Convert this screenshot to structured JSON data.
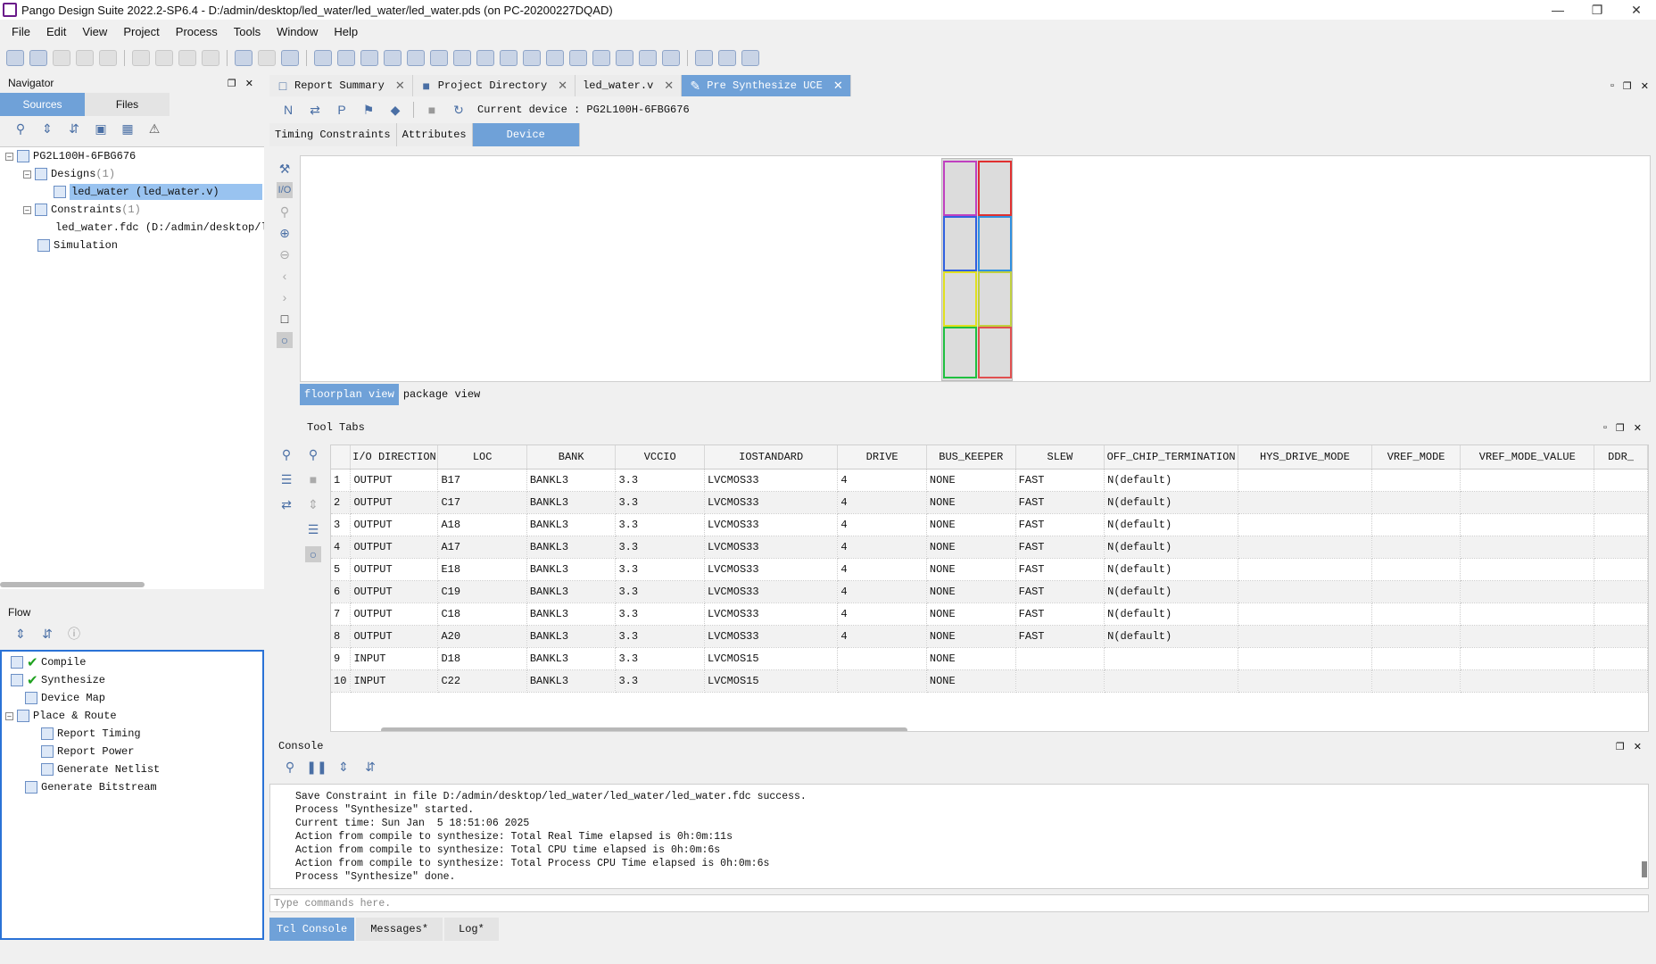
{
  "window": {
    "title": "Pango Design Suite 2022.2-SP6.4 - D:/admin/desktop/led_water/led_water/led_water.pds (on PC-20200227DQAD)"
  },
  "menu": [
    "File",
    "Edit",
    "View",
    "Project",
    "Process",
    "Tools",
    "Window",
    "Help"
  ],
  "navigator": {
    "title": "Navigator",
    "tabs": {
      "sources": "Sources",
      "files": "Files"
    },
    "tree": {
      "device": "PG2L100H-6FBG676",
      "designs": "Designs",
      "designs_count": "(1)",
      "design_item": "led_water (led_water.v)",
      "constraints": "Constraints",
      "constraints_count": "(1)",
      "constraint_item": "led_water.fdc (D:/admin/desktop/l",
      "simulation": "Simulation"
    }
  },
  "flow": {
    "title": "Flow",
    "items": {
      "compile": "Compile",
      "synthesize": "Synthesize",
      "device_map": "Device Map",
      "place_route": "Place & Route",
      "report_timing": "Report Timing",
      "report_power": "Report Power",
      "generate_netlist": "Generate Netlist",
      "generate_bitstream": "Generate Bitstream"
    }
  },
  "editor": {
    "tabs": {
      "report_summary": "Report Summary",
      "project_directory": "Project Directory",
      "led_water_v": "led_water.v",
      "pre_synth_uce": "Pre Synthesize UCE"
    },
    "current_device": "Current device : PG2L100H-6FBG676",
    "subtabs": {
      "timing": "Timing Constraints",
      "attributes": "Attributes",
      "device": "Device"
    },
    "views": {
      "floorplan": "floorplan view",
      "package": "package view"
    }
  },
  "tool_tabs": {
    "title": "Tool Tabs",
    "columns": [
      "",
      "I/O DIRECTION",
      "LOC",
      "BANK",
      "VCCIO",
      "IOSTANDARD",
      "DRIVE",
      "BUS_KEEPER",
      "SLEW",
      "OFF_CHIP_TERMINATION",
      "HYS_DRIVE_MODE",
      "VREF_MODE",
      "VREF_MODE_VALUE",
      "DDR_"
    ],
    "rows": [
      [
        "1",
        "OUTPUT",
        "B17",
        "BANKL3",
        "3.3",
        "LVCMOS33",
        "4",
        "NONE",
        "FAST",
        "N(default)",
        "",
        "",
        "",
        ""
      ],
      [
        "2",
        "OUTPUT",
        "C17",
        "BANKL3",
        "3.3",
        "LVCMOS33",
        "4",
        "NONE",
        "FAST",
        "N(default)",
        "",
        "",
        "",
        ""
      ],
      [
        "3",
        "OUTPUT",
        "A18",
        "BANKL3",
        "3.3",
        "LVCMOS33",
        "4",
        "NONE",
        "FAST",
        "N(default)",
        "",
        "",
        "",
        ""
      ],
      [
        "4",
        "OUTPUT",
        "A17",
        "BANKL3",
        "3.3",
        "LVCMOS33",
        "4",
        "NONE",
        "FAST",
        "N(default)",
        "",
        "",
        "",
        ""
      ],
      [
        "5",
        "OUTPUT",
        "E18",
        "BANKL3",
        "3.3",
        "LVCMOS33",
        "4",
        "NONE",
        "FAST",
        "N(default)",
        "",
        "",
        "",
        ""
      ],
      [
        "6",
        "OUTPUT",
        "C19",
        "BANKL3",
        "3.3",
        "LVCMOS33",
        "4",
        "NONE",
        "FAST",
        "N(default)",
        "",
        "",
        "",
        ""
      ],
      [
        "7",
        "OUTPUT",
        "C18",
        "BANKL3",
        "3.3",
        "LVCMOS33",
        "4",
        "NONE",
        "FAST",
        "N(default)",
        "",
        "",
        "",
        ""
      ],
      [
        "8",
        "OUTPUT",
        "A20",
        "BANKL3",
        "3.3",
        "LVCMOS33",
        "4",
        "NONE",
        "FAST",
        "N(default)",
        "",
        "",
        "",
        ""
      ],
      [
        "9",
        "INPUT",
        "D18",
        "BANKL3",
        "3.3",
        "LVCMOS15",
        "",
        "NONE",
        "",
        "",
        "",
        "",
        "",
        ""
      ],
      [
        "10",
        "INPUT",
        "C22",
        "BANKL3",
        "3.3",
        "LVCMOS15",
        "",
        "NONE",
        "",
        "",
        "",
        "",
        "",
        ""
      ]
    ]
  },
  "console": {
    "title": "Console",
    "lines": [
      "Save Constraint in file D:/admin/desktop/led_water/led_water/led_water.fdc success.",
      "Process \"Synthesize\" started.",
      "Current time: Sun Jan  5 18:51:06 2025",
      "Action from compile to synthesize: Total Real Time elapsed is 0h:0m:11s",
      "Action from compile to synthesize: Total CPU time elapsed is 0h:0m:6s",
      "Action from compile to synthesize: Total Process CPU Time elapsed is 0h:0m:6s",
      "Process \"Synthesize\" done."
    ],
    "command_placeholder": "Type commands here.",
    "tabs": {
      "tcl": "Tcl Console",
      "messages": "Messages*",
      "log": "Log*"
    }
  }
}
